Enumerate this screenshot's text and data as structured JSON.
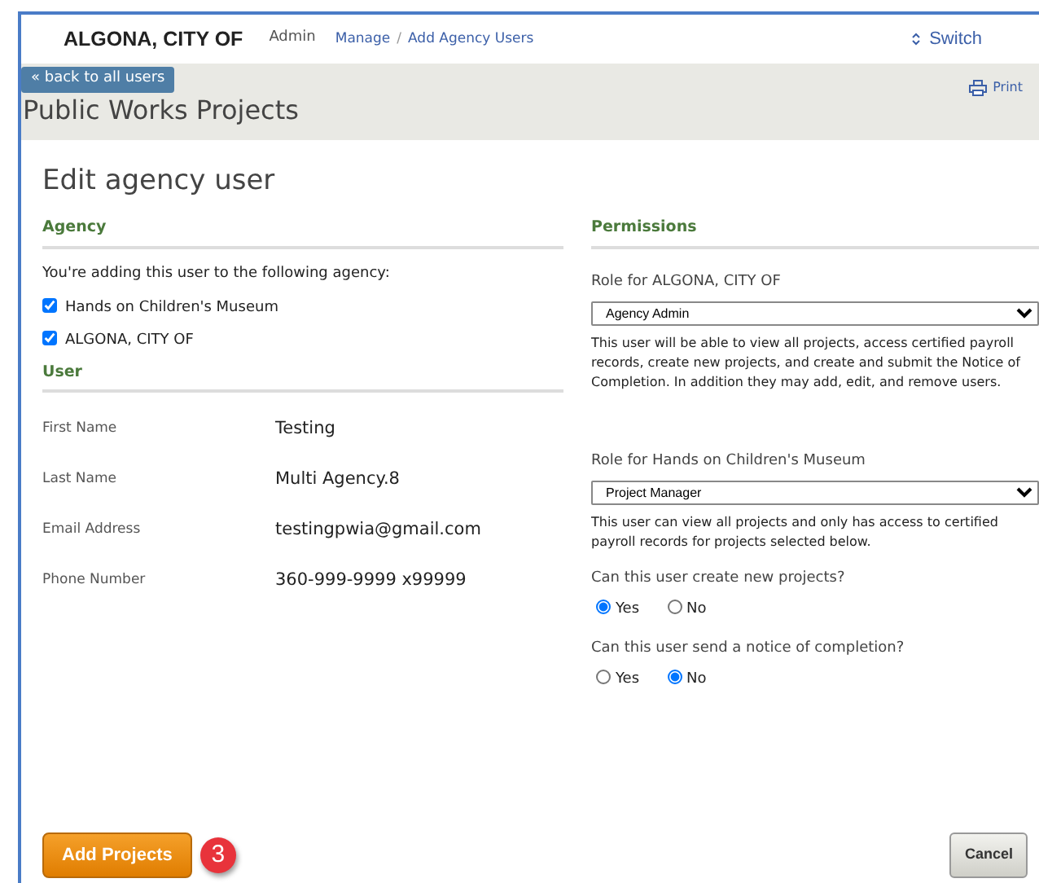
{
  "header": {
    "organization": "ALGONA, CITY OF",
    "role": "Admin",
    "breadcrumb": [
      {
        "label": "Manage"
      },
      {
        "label": "Add Agency Users"
      }
    ],
    "breadcrumb_separator": "/",
    "switch_label": "Switch"
  },
  "subheader": {
    "back_link": "« back to all users",
    "print_label": "Print",
    "title": "Public Works Projects"
  },
  "form": {
    "title": "Edit agency user",
    "agency": {
      "heading": "Agency",
      "intro": "You're adding this user to the following agency:",
      "agencies": [
        {
          "label": "Hands on Children's Museum",
          "checked": true
        },
        {
          "label": "ALGONA, CITY OF",
          "checked": true
        }
      ]
    },
    "user": {
      "heading": "User",
      "fields": [
        {
          "label": "First Name",
          "value": "Testing"
        },
        {
          "label": "Last Name",
          "value": "Multi Agency.8"
        },
        {
          "label": "Email Address",
          "value": "testingpwia@gmail.com"
        },
        {
          "label": "Phone Number",
          "value": "360-999-9999 x99999"
        }
      ]
    },
    "permissions": {
      "heading": "Permissions",
      "roles": [
        {
          "label": "Role for ALGONA, CITY OF",
          "value": "Agency Admin",
          "description": "This user will be able to view all projects, access certified payroll records, create new projects, and create and submit the Notice of Completion. In addition they may add, edit, and remove users."
        },
        {
          "label": "Role for Hands on Children's Museum",
          "value": "Project Manager",
          "description": "This user can view all projects and only has access to certified payroll records for projects selected below."
        }
      ],
      "questions": [
        {
          "label": "Can this user create new projects?",
          "options": [
            {
              "label": "Yes",
              "selected": true
            },
            {
              "label": "No",
              "selected": false
            }
          ]
        },
        {
          "label": "Can this user send a notice of completion?",
          "options": [
            {
              "label": "Yes",
              "selected": false
            },
            {
              "label": "No",
              "selected": true
            }
          ]
        }
      ]
    }
  },
  "buttons": {
    "primary": "Add Projects",
    "step_badge": "3",
    "cancel": "Cancel"
  }
}
